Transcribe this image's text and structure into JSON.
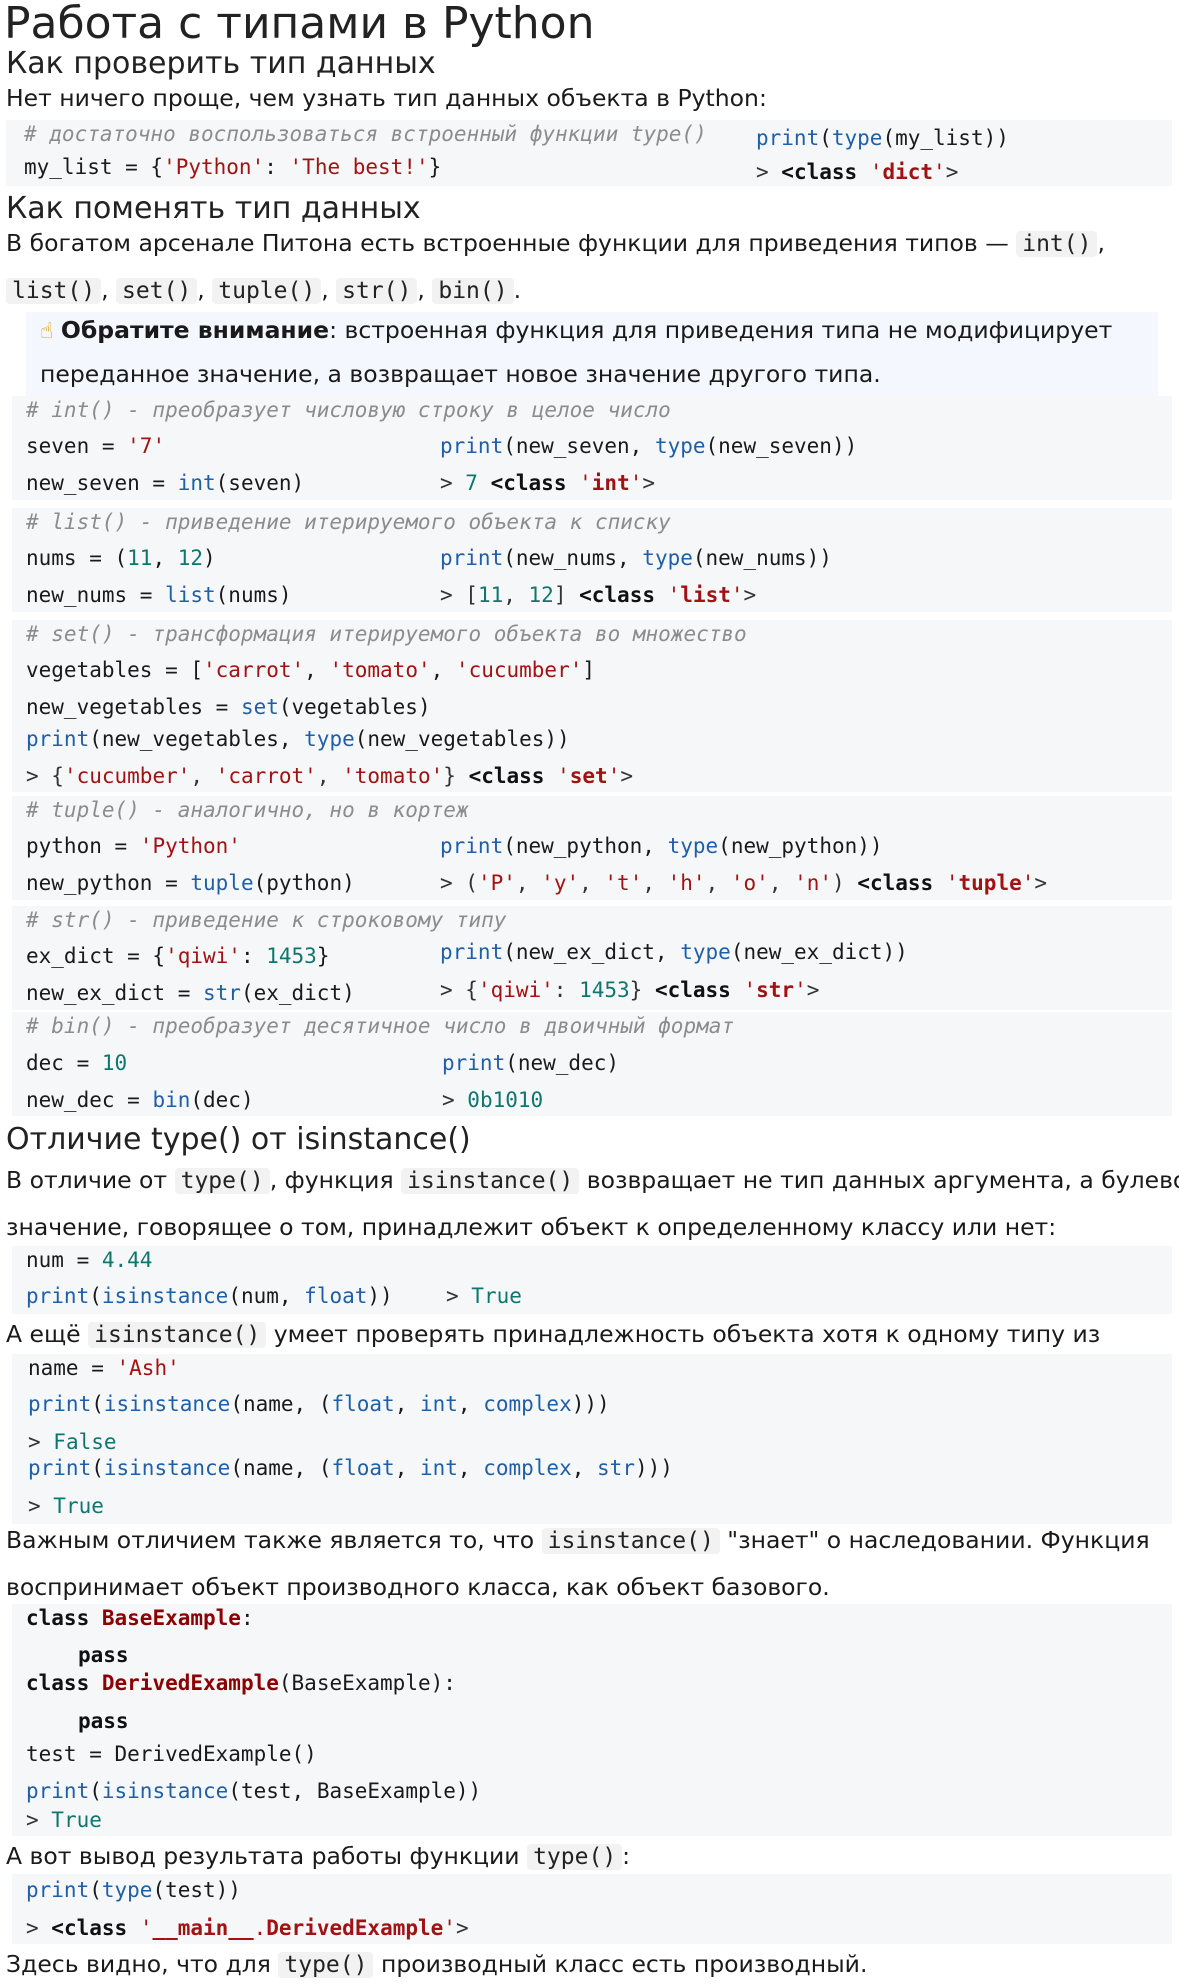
{
  "title": "Работа с типами в Python",
  "s1": {
    "heading": "Как проверить тип данных",
    "intro": "Нет ничего проще, чем узнать тип данных объекта в Python:",
    "comment": "# достаточно воспользоваться встроенный функции type()",
    "code": "my_list = {'Python': 'The best!'}",
    "print": "print(type(my_list))",
    "output": "> <class 'dict'>"
  },
  "s2": {
    "heading": "Как поменять тип данных",
    "text1": "В богатом арсенале Питона есть встроенные функции для приведения типов —",
    "funcs": [
      "int()",
      "list()",
      "set()",
      "tuple()",
      "str()",
      "bin()"
    ],
    "note_title": "Обратите внимание",
    "note_text1": ": встроенная функция для приведения типа не модифицирует",
    "note_text2": "переданное значение, а возвращает новое значение другого типа.",
    "blocks": [
      {
        "comment": "# int() - преобразует числовую строку в целое число",
        "lines": [
          "seven = '7'",
          "new_seven = int(seven)"
        ],
        "print": "print(new_seven, type(new_seven))",
        "output": "> 7 <class 'int'>"
      },
      {
        "comment": "# list() - приведение итерируемого объекта к списку",
        "lines": [
          "nums = (11, 12)",
          "new_nums = list(nums)"
        ],
        "print": "print(new_nums, type(new_nums))",
        "output": "> [11, 12] <class 'list'>"
      },
      {
        "comment": "# set() - трансформация итерируемого объекта во множество",
        "lines": [
          "vegetables = ['carrot', 'tomato', 'cucumber']",
          "new_vegetables = set(vegetables)"
        ],
        "print": "print(new_vegetables, type(new_vegetables))",
        "output": "> {'cucumber', 'carrot', 'tomato'} <class 'set'>"
      },
      {
        "comment": "# tuple() - аналогично, но в кортеж",
        "lines": [
          "python = 'Python'",
          "new_python = tuple(python)"
        ],
        "print": "print(new_python, type(new_python))",
        "output": "> ('P', 'y', 't', 'h', 'o', 'n') <class 'tuple'>"
      },
      {
        "comment": "# str() - приведение к строковому типу",
        "lines": [
          "ex_dict = {'qiwi': 1453}",
          "new_ex_dict = str(ex_dict)"
        ],
        "print": "print(new_ex_dict, type(new_ex_dict))",
        "output": "> {'qiwi': 1453} <class 'str'>"
      },
      {
        "comment": "# bin() - преобразует десятичное число в двоичный формат",
        "lines": [
          "dec = 10",
          "new_dec = bin(dec)"
        ],
        "print": "print(new_dec)",
        "output": "> 0b1010"
      }
    ]
  },
  "s3": {
    "heading": "Отличие type() от isinstance()",
    "p1_a": "В отличие от",
    "p1_code1": "type()",
    "p1_b": ", функция",
    "p1_code2": "isinstance()",
    "p1_c": "возвращает не тип данных аргумента, а булево",
    "p1_line2": "значение, говорящее о том, принадлежит объект к определенному классу или нет:",
    "ex1": {
      "line1": "num = 4.44",
      "line2": "print(isinstance(num, float))",
      "output": "> True"
    },
    "p2_a": "А ещё",
    "p2_code": "isinstance()",
    "p2_b": "умеет проверять принадлежность объекта хотя к одному типу из",
    "ex2": {
      "line1": "name = 'Ash'",
      "line2": "print(isinstance(name, (float, int, complex)))",
      "out1": "> False",
      "line3": "print(isinstance(name, (float, int, complex, str)))",
      "out2": "> True"
    },
    "p3_a": "Важным отличием также является то, что",
    "p3_code": "isinstance()",
    "p3_b": "\"знает\" о наследовании. Функция",
    "p3_line2": "воспринимает объект производного класса, как объект базового.",
    "ex3": {
      "line1": "class BaseExample:",
      "line2": "pass",
      "line3": "class DerivedExample(BaseExample):",
      "line4": "pass",
      "line5": "test = DerivedExample()",
      "line6": "print(isinstance(test, BaseExample))",
      "out": "> True"
    },
    "p4_a": "А вот вывод результата работы функции",
    "p4_code": "type()",
    "p4_b": ":",
    "ex4": {
      "line1": "print(type(test))",
      "out": "> <class '__main__.DerivedExample'>"
    },
    "p5_a": "Здесь видно, что для",
    "p5_code": "type()",
    "p5_b": "производный класс есть производный."
  }
}
